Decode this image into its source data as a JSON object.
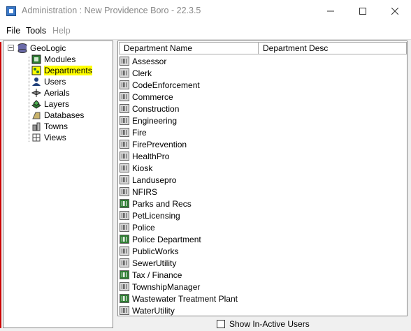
{
  "window": {
    "title": "Administration : New Providence Boro - 22.3.5"
  },
  "menu": {
    "items": [
      {
        "label": "File",
        "enabled": true
      },
      {
        "label": "Tools",
        "enabled": true
      },
      {
        "label": "Help",
        "enabled": false
      }
    ]
  },
  "tree": {
    "root": "GeoLogic",
    "children": [
      {
        "label": "Modules",
        "icon": "modules-icon"
      },
      {
        "label": "Departments",
        "icon": "departments-icon",
        "selected": true
      },
      {
        "label": "Users",
        "icon": "users-icon"
      },
      {
        "label": "Aerials",
        "icon": "aerials-icon"
      },
      {
        "label": "Layers",
        "icon": "layers-icon"
      },
      {
        "label": "Databases",
        "icon": "databases-icon"
      },
      {
        "label": "Towns",
        "icon": "towns-icon"
      },
      {
        "label": "Views",
        "icon": "views-icon"
      }
    ]
  },
  "table": {
    "columns": [
      "Department Name",
      "Department Desc"
    ],
    "rows": [
      {
        "name": "Assessor",
        "active": false
      },
      {
        "name": "Clerk",
        "active": false
      },
      {
        "name": "CodeEnforcement",
        "active": false
      },
      {
        "name": "Commerce",
        "active": false
      },
      {
        "name": "Construction",
        "active": false
      },
      {
        "name": "Engineering",
        "active": false
      },
      {
        "name": "Fire",
        "active": false
      },
      {
        "name": "FirePrevention",
        "active": false
      },
      {
        "name": "HealthPro",
        "active": false
      },
      {
        "name": "Kiosk",
        "active": false
      },
      {
        "name": "Landusepro",
        "active": false
      },
      {
        "name": "NFIRS",
        "active": false
      },
      {
        "name": "Parks and Recs",
        "active": true
      },
      {
        "name": "PetLicensing",
        "active": false
      },
      {
        "name": "Police",
        "active": false
      },
      {
        "name": "Police Department",
        "active": true
      },
      {
        "name": "PublicWorks",
        "active": false
      },
      {
        "name": "SewerUtility",
        "active": false
      },
      {
        "name": "Tax / Finance",
        "active": true
      },
      {
        "name": "TownshipManager",
        "active": false
      },
      {
        "name": "Wastewater Treatment Plant",
        "active": true
      },
      {
        "name": "WaterUtility",
        "active": false
      }
    ]
  },
  "footer": {
    "show_inactive_label": "Show In-Active Users",
    "show_inactive_checked": false
  },
  "colors": {
    "highlight": "#ffff00",
    "active_icon": "#2e7d32"
  }
}
